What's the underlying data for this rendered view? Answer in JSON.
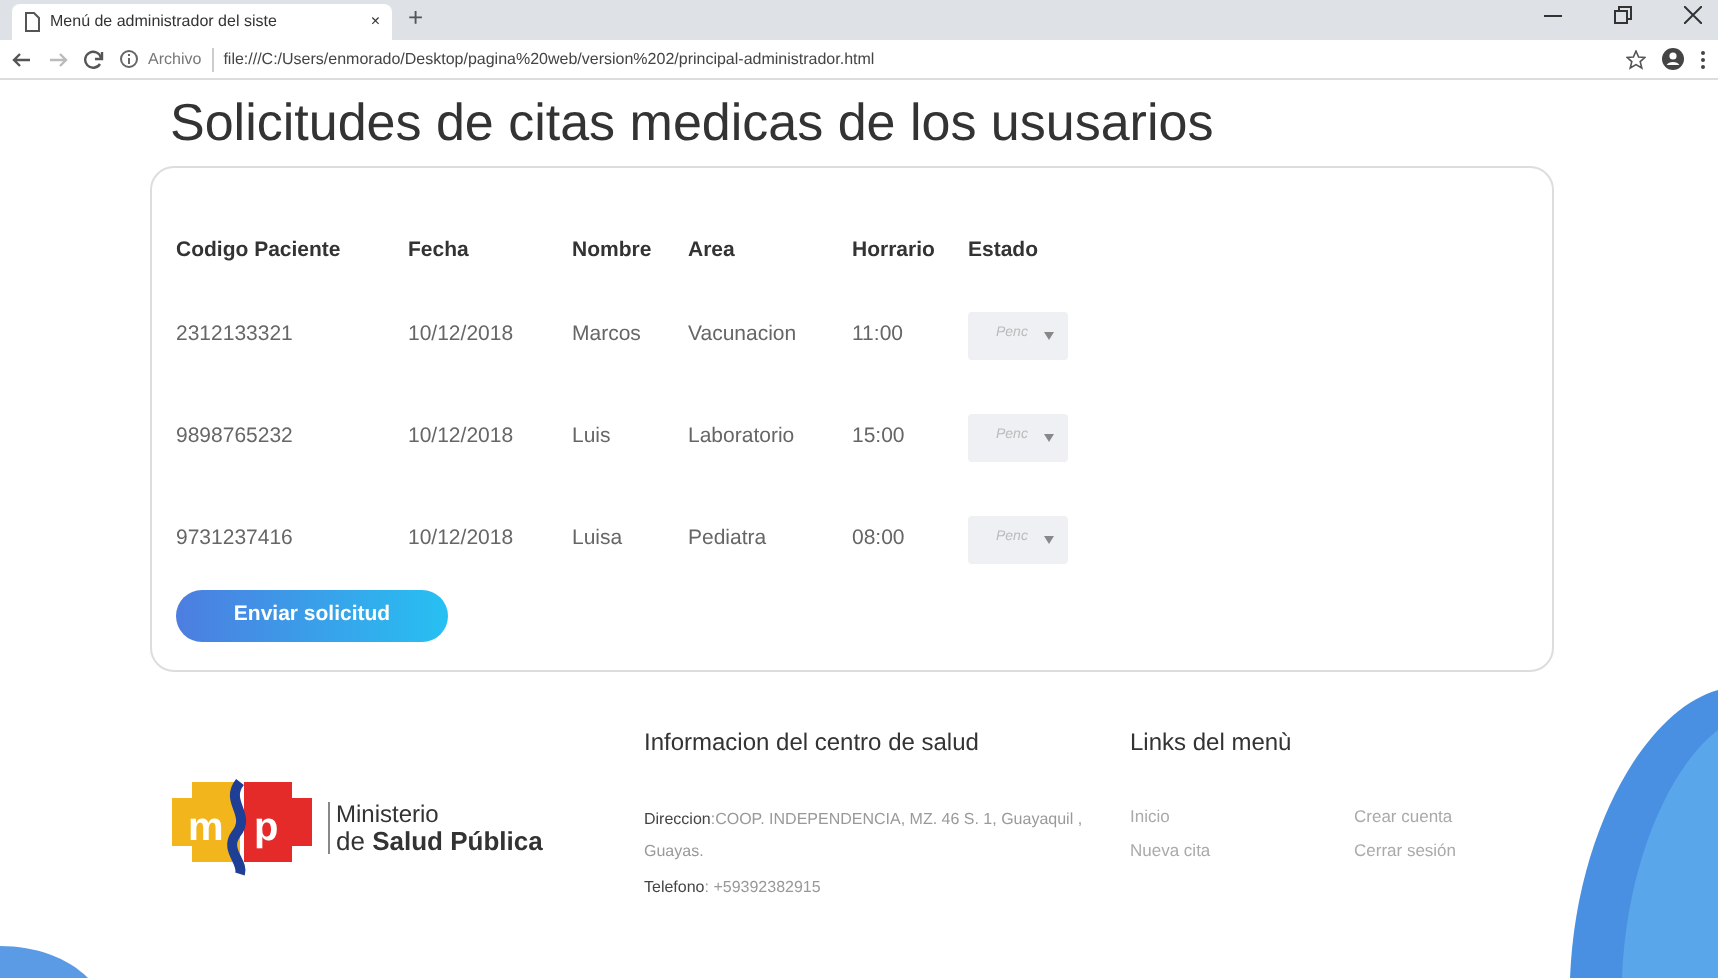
{
  "browser": {
    "tab_title": "Menú de administrador del siste",
    "tab_close": "×",
    "new_tab": "+",
    "url_label": "Archivo",
    "url": "file:///C:/Users/enmorado/Desktop/pagina%20web/version%202/principal-administrador.html"
  },
  "page_title": "Solicitudes de citas medicas de los ususarios",
  "table": {
    "columns": [
      "Codigo Paciente",
      "Fecha",
      "Nombre",
      "Area",
      "Horrario",
      "Estado"
    ],
    "rows": [
      {
        "codigo": "2312133321",
        "fecha": "10/12/2018",
        "nombre": "Marcos",
        "area": "Vacunacion",
        "horario": "11:00",
        "estado": "Penc"
      },
      {
        "codigo": "9898765232",
        "fecha": "10/12/2018",
        "nombre": "Luis",
        "area": "Laboratorio",
        "horario": "15:00",
        "estado": "Penc"
      },
      {
        "codigo": "9731237416",
        "fecha": "10/12/2018",
        "nombre": "Luisa",
        "area": "Pediatra",
        "horario": "08:00",
        "estado": "Penc"
      }
    ]
  },
  "submit_button": "Enviar solicitud",
  "footer": {
    "logo": {
      "letter_left": "m",
      "letter_right": "p",
      "line1": "Ministerio",
      "line2": "de **Salud Pública**"
    },
    "info": {
      "heading": "Informacion del centro de salud",
      "address": "**Direccion**:COOP. INDEPENDENCIA, MZ. 46 S. 1, Guayaquil , Guayas.",
      "phone": "**Telefono**: +59392382915"
    },
    "links": {
      "heading": "Links del menù",
      "items": [
        "Inicio",
        "Crear cuenta",
        "Nueva cita",
        "Cerrar sesión"
      ]
    }
  }
}
